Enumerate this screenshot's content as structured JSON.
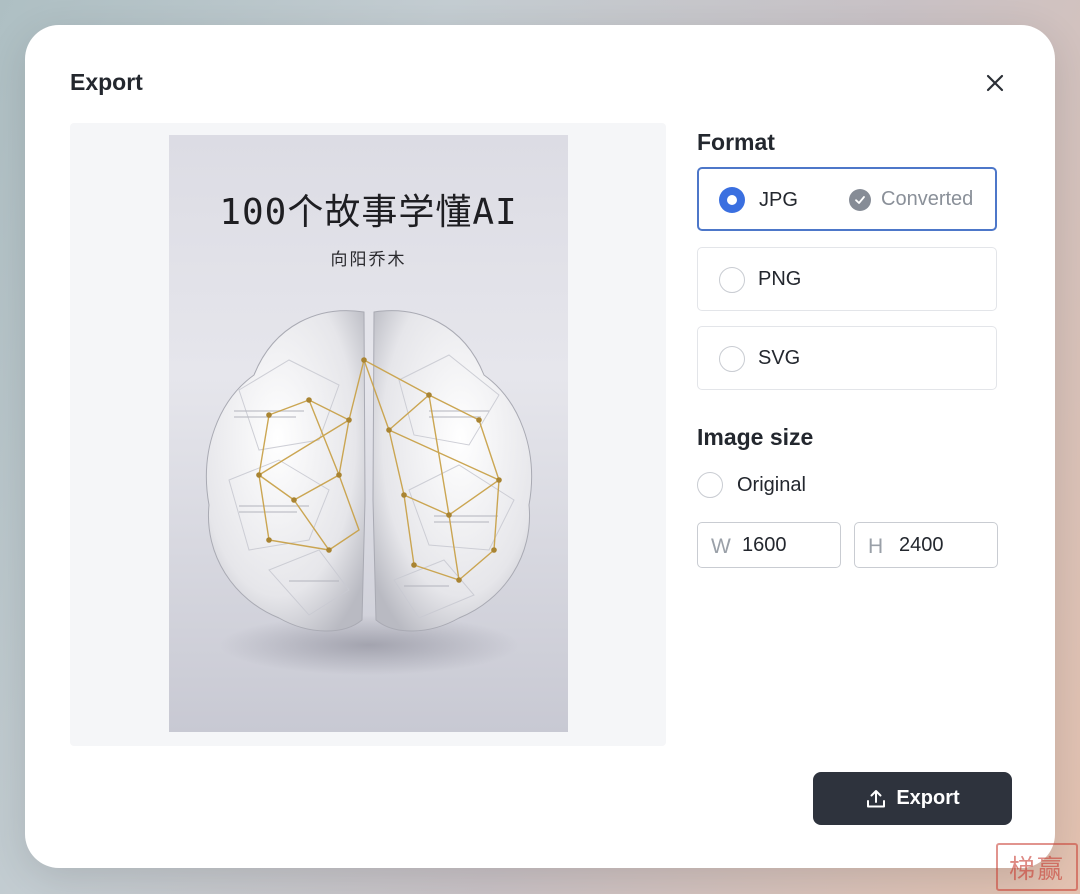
{
  "dialog": {
    "title": "Export",
    "close_icon": "close-icon"
  },
  "preview": {
    "book_title": "100个故事学懂AI",
    "book_author": "向阳乔木",
    "illustration": "paper-brain-with-gold-network"
  },
  "format": {
    "label": "Format",
    "options": [
      {
        "label": "JPG",
        "selected": true,
        "badge": "Converted",
        "badge_icon": "check-circle-icon"
      },
      {
        "label": "PNG",
        "selected": false
      },
      {
        "label": "SVG",
        "selected": false
      }
    ]
  },
  "image_size": {
    "label": "Image size",
    "original_label": "Original",
    "width_prefix": "W",
    "width_value": "1600",
    "height_prefix": "H",
    "height_value": "2400"
  },
  "export_button": {
    "label": "Export",
    "icon": "upload-icon"
  },
  "colors": {
    "accent": "#3a6fe0",
    "button_bg": "#2e333d",
    "selected_border": "#4d77c9"
  },
  "watermark": "梯赢"
}
